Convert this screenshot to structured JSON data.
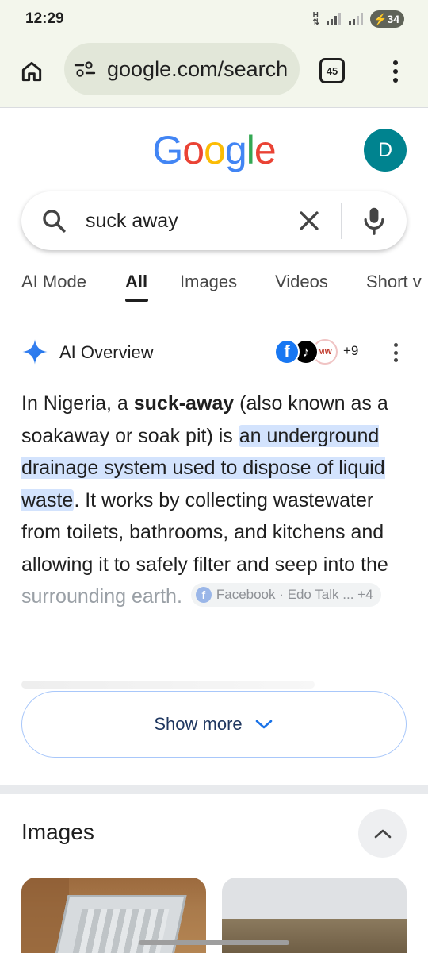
{
  "status_bar": {
    "time": "12:29",
    "network": "H",
    "battery": "34"
  },
  "browser": {
    "url": "google.com/search",
    "tab_count": "45"
  },
  "google": {
    "logo": "Google",
    "avatar_letter": "D",
    "logo_colors": [
      "#4285F4",
      "#EA4335",
      "#FBBC05",
      "#4285F4",
      "#34A853",
      "#EA4335"
    ]
  },
  "search": {
    "query": "suck away"
  },
  "tabs": [
    {
      "label": "AI Mode",
      "active": false
    },
    {
      "label": "All",
      "active": true
    },
    {
      "label": "Images",
      "active": false
    },
    {
      "label": "Videos",
      "active": false
    },
    {
      "label": "Short v",
      "active": false
    }
  ],
  "ai_overview": {
    "title": "AI Overview",
    "more_sources": "+9",
    "source_icons": [
      "facebook-icon",
      "tiktok-icon",
      "mw-icon"
    ],
    "body": {
      "p1": "In Nigeria, a ",
      "bold": "suck-away",
      "p2": " (also known as a soakaway or soak pit) is ",
      "highlight": "an underground drainage system used to dispose of liquid waste",
      "p3": ". It works by collecting wastewater from toilets, bathrooms, and kitchens and allowing it to safely filter and seep into the ",
      "faded": "surrounding earth."
    },
    "source_chip": {
      "text": "Facebook · Edo Talk ...",
      "count": "+4"
    },
    "show_more": "Show more"
  },
  "images_section": {
    "title": "Images"
  },
  "colors": {
    "accent_blue": "#1a73e8",
    "highlight": "#d3e3fd",
    "chrome_bg": "#f3f6ec",
    "avatar_bg": "#00838f"
  }
}
